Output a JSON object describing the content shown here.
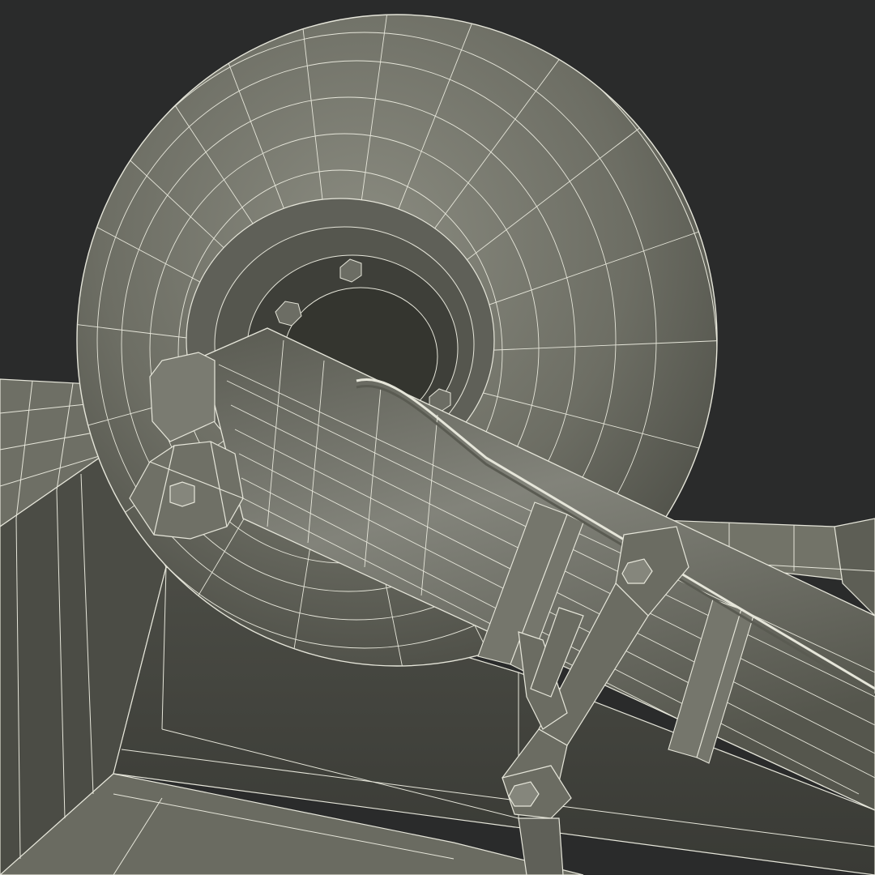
{
  "scene": {
    "subject": "wireframe-3d-model",
    "colors": {
      "background": "#2a2b2b",
      "surface_light": "#7d7e72",
      "surface_mid": "#66675d",
      "surface_dark": "#44453f",
      "wire": "#e9e9dd"
    }
  }
}
